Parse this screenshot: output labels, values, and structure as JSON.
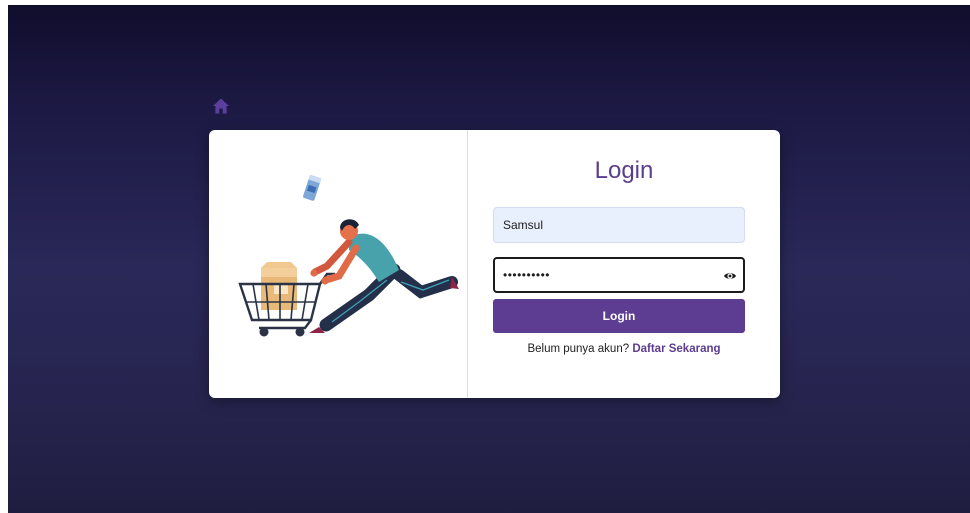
{
  "icons": {
    "home": "home-icon",
    "eye": "eye-icon",
    "illustration": "shopping-cart-illustration"
  },
  "colors": {
    "accent": "#5c3d91",
    "background_top": "#110d2c",
    "background_mid": "#2a2858",
    "input_fill": "#e8effd"
  },
  "login": {
    "title": "Login",
    "username_value": "Samsul",
    "password_value": "••••••••••",
    "button_label": "Login",
    "register_prompt": "Belum punya akun?",
    "register_link": "Daftar Sekarang"
  }
}
